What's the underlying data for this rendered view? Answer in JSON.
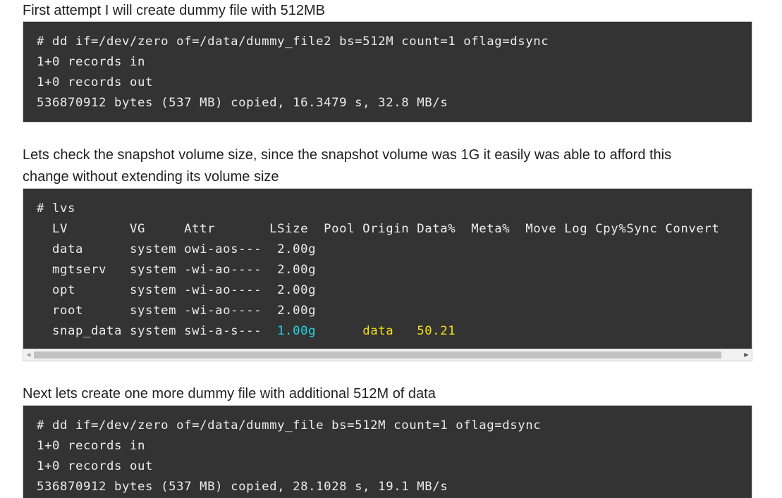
{
  "para1": "First attempt I will create dummy file with 512MB",
  "code1": [
    "# dd if=/dev/zero of=/data/dummy_file2 bs=512M count=1 oflag=dsync",
    "1+0 records in",
    "1+0 records out",
    "536870912 bytes (537 MB) copied, 16.3479 s, 32.8 MB/s"
  ],
  "para2": "Lets check the snapshot volume size, since the snapshot volume was 1G it easily was able to afford this change without extending its volume size",
  "lvs": {
    "command": "# lvs",
    "header": "  LV        VG     Attr       LSize  Pool Origin Data%  Meta%  Move Log Cpy%Sync Convert",
    "rows": [
      "  data      system owi-aos---  2.00g",
      "  mgtserv   system -wi-ao----  2.00g",
      "  opt       system -wi-ao----  2.00g",
      "  root      system -wi-ao----  2.00g"
    ],
    "snap_prefix": "  snap_data system swi-a-s---  ",
    "snap_lsize": "1.00g",
    "snap_gap1": "      ",
    "snap_origin": "data",
    "snap_gap2": "   ",
    "snap_data_pct": "50.21"
  },
  "para3": "Next lets create one more dummy file with additional 512M of data",
  "code3": [
    "# dd if=/dev/zero of=/data/dummy_file bs=512M count=1 oflag=dsync",
    "1+0 records in",
    "1+0 records out",
    "536870912 bytes (537 MB) copied, 28.1028 s, 19.1 MB/s"
  ],
  "colors": {
    "code_background": "#333333",
    "code_text": "#ececec",
    "highlight_cyan": "#24d6e0",
    "highlight_yellow": "#f3e01a"
  },
  "icons": {
    "scroll_left": "triangle-left",
    "scroll_right": "triangle-right"
  }
}
